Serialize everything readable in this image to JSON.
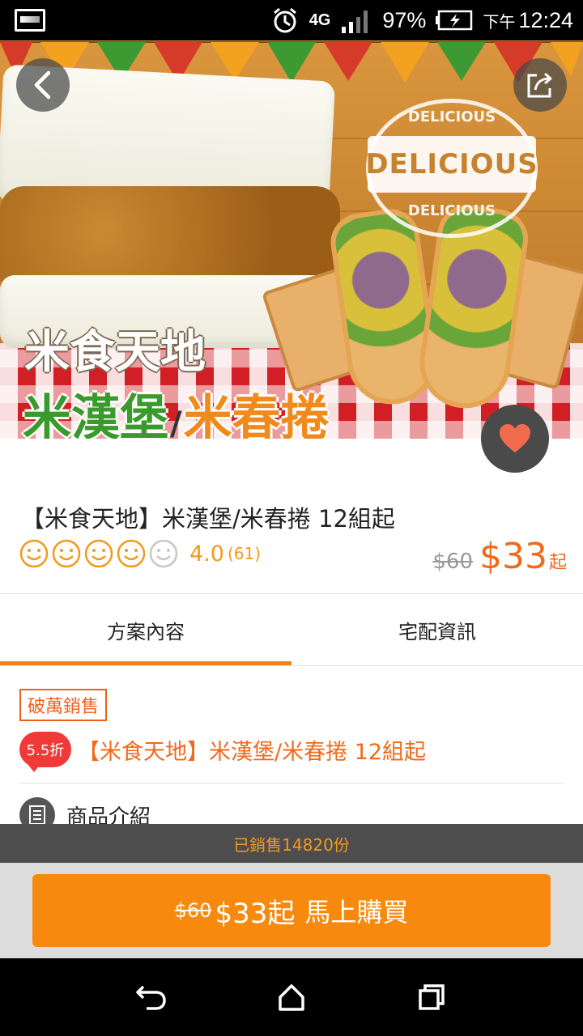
{
  "status_bar": {
    "network": "4G",
    "battery": "97%",
    "ampm": "下午",
    "time": "12:24",
    "icons": [
      "gallery-icon",
      "alarm-icon",
      "4g-data-icon",
      "signal-icon",
      "battery-charging-icon"
    ]
  },
  "hero": {
    "stamp_main": "DELICIOUS",
    "stamp_top": "DELICIOUS",
    "stamp_bottom": "DELICIOUS",
    "brand_text": "米食天地",
    "product_green": "米漢堡",
    "separator": "/",
    "product_orange": "米春捲"
  },
  "header": {
    "back_icon": "chevron-left-icon",
    "share_icon": "share-icon",
    "favorite_icon": "heart-icon"
  },
  "product": {
    "title": "【米食天地】米漢堡/米春捲 12組起",
    "rating": {
      "stars_filled": 4,
      "stars_total": 5,
      "score": "4.0",
      "count": "(61)"
    },
    "original_price": "$60",
    "price": "$33",
    "price_suffix": "起"
  },
  "tabs": [
    {
      "label": "方案內容",
      "active": true
    },
    {
      "label": "宅配資訊",
      "active": false
    }
  ],
  "content": {
    "tag": "破萬銷售",
    "discount_badge": "5.5折",
    "deal_title": "【米食天地】米漢堡/米春捲 12組起",
    "section_label": "商品介紹"
  },
  "sold_bar": {
    "text": "已銷售14820份"
  },
  "buy_button": {
    "original_price": "$60",
    "price": "$33起",
    "label": "馬上購買"
  },
  "colors": {
    "accent_orange": "#f78a0e",
    "price_orange": "#f06a1c",
    "rating_orange": "#f39a1c",
    "badge_red": "#f03a38",
    "heart": "#f26b4d"
  },
  "nav_bar": {
    "icons": [
      "back-nav-icon",
      "home-icon",
      "recents-icon"
    ]
  }
}
